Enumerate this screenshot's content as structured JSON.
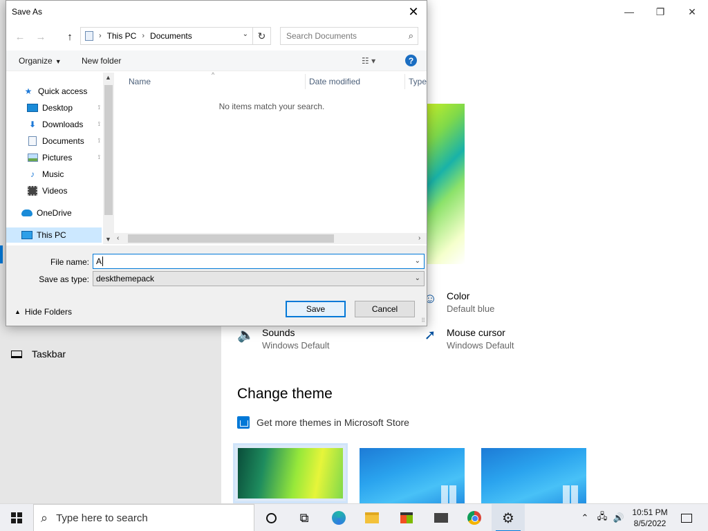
{
  "settings": {
    "window_controls": {
      "minimize": "—",
      "maximize": "❐",
      "close": "✕"
    },
    "nav": {
      "taskbar_label": "Taskbar"
    },
    "color": {
      "title": "Color",
      "value": "Default blue",
      "icon": "palette-icon"
    },
    "sounds": {
      "title": "Sounds",
      "value": "Windows Default",
      "icon": "speaker-icon"
    },
    "mouse_cursor": {
      "title": "Mouse cursor",
      "value": "Windows Default",
      "icon": "cursor-icon"
    },
    "change_theme_heading": "Change theme",
    "store_link": "Get more themes in Microsoft Store",
    "accent_color": "#0078d7"
  },
  "dialog": {
    "title": "Save As",
    "close_glyph": "✕",
    "nav": {
      "back": "←",
      "forward": "→",
      "up": "↑"
    },
    "address": {
      "crumbs": [
        "This PC",
        "Documents"
      ],
      "separator": "›",
      "dropdown": "⌄",
      "refresh": "↻"
    },
    "search": {
      "placeholder": "Search Documents",
      "icon": "⌕"
    },
    "toolbar": {
      "organize": "Organize",
      "new_folder": "New folder",
      "view": "☷ ▾",
      "help": "?"
    },
    "nav_pane": {
      "quick_access": "Quick access",
      "items": [
        {
          "label": "Desktop",
          "pinned": true
        },
        {
          "label": "Downloads",
          "pinned": true
        },
        {
          "label": "Documents",
          "pinned": true
        },
        {
          "label": "Pictures",
          "pinned": true
        },
        {
          "label": "Music",
          "pinned": false
        },
        {
          "label": "Videos",
          "pinned": false
        }
      ],
      "onedrive": "OneDrive",
      "this_pc": "This PC",
      "pin_glyph": "📌"
    },
    "file_list": {
      "columns": [
        "Name",
        "Date modified",
        "Type"
      ],
      "empty_message": "No items match your search."
    },
    "file_name": {
      "label": "File name:",
      "value": "A"
    },
    "save_as_type": {
      "label": "Save as type:",
      "value": "deskthemepack"
    },
    "hide_folders": "Hide Folders",
    "buttons": {
      "save": "Save",
      "cancel": "Cancel"
    }
  },
  "taskbar": {
    "search_placeholder": "Type here to search",
    "clock": {
      "time": "10:51 PM",
      "date": "8/5/2022"
    },
    "apps": [
      "cortana-icon",
      "task-view-icon",
      "edge-icon",
      "file-explorer-icon",
      "store-icon",
      "mail-icon",
      "chrome-icon",
      "settings-icon"
    ]
  }
}
